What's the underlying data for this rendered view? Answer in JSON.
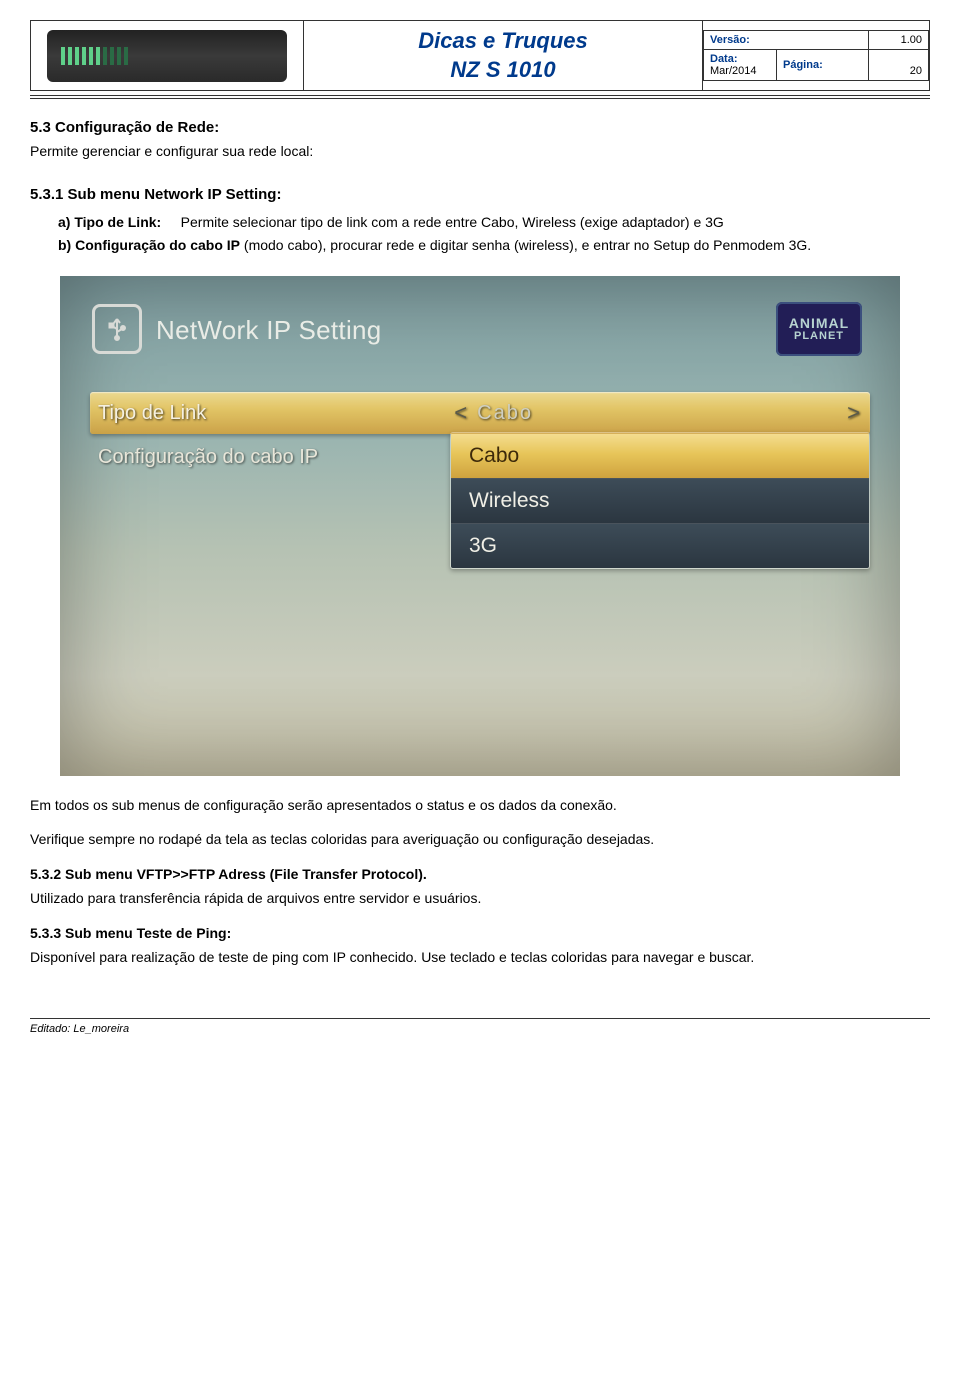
{
  "header": {
    "title_line1": "Dicas e Truques",
    "title_line2": "NZ S 1010",
    "meta": {
      "versao_label": "Versão:",
      "versao_value": "1.00",
      "data_label": "Data:",
      "data_value": "Mar/2014",
      "pagina_label": "Página:",
      "pagina_value": "20"
    }
  },
  "sec53": {
    "heading": "5.3 Configuração de Rede:",
    "intro": "Permite gerenciar e configurar sua rede local:"
  },
  "sec531": {
    "heading": "5.3.1 Sub menu Network IP Setting:",
    "li_a_label": "a) Tipo de Link:",
    "li_a_text": "Permite selecionar tipo de link com a rede entre Cabo, Wireless (exige adaptador) e 3G",
    "li_b_label": "b) Configuração do cabo IP",
    "li_b_text": " (modo cabo), procurar rede e digitar senha (wireless), e entrar no Setup do Penmodem 3G."
  },
  "tv": {
    "usb_icon": "usb-icon",
    "title": "NetWork IP Setting",
    "logo_l1": "ANIMAL",
    "logo_l2": "PLANET",
    "row1_label": "Tipo de Link",
    "row1_value": "Cabo",
    "row2_label": "Configuração do cabo IP",
    "options": [
      "Cabo",
      "Wireless",
      "3G"
    ]
  },
  "after": {
    "p1": "Em todos os sub menus de configuração serão apresentados o status e os dados da conexão.",
    "p2": "Verifique sempre no rodapé da tela as teclas coloridas para averiguação ou configuração desejadas."
  },
  "sec532": {
    "heading": "5.3.2 Sub menu VFTP>>FTP Adress (File Transfer Protocol).",
    "text": "Utilizado para transferência rápida de arquivos entre servidor e usuários."
  },
  "sec533": {
    "heading": "5.3.3 Sub menu Teste de Ping:",
    "text": "Disponível para realização de teste de ping com IP conhecido. Use teclado e teclas coloridas para navegar e buscar."
  },
  "footer": "Editado: Le_moreira"
}
